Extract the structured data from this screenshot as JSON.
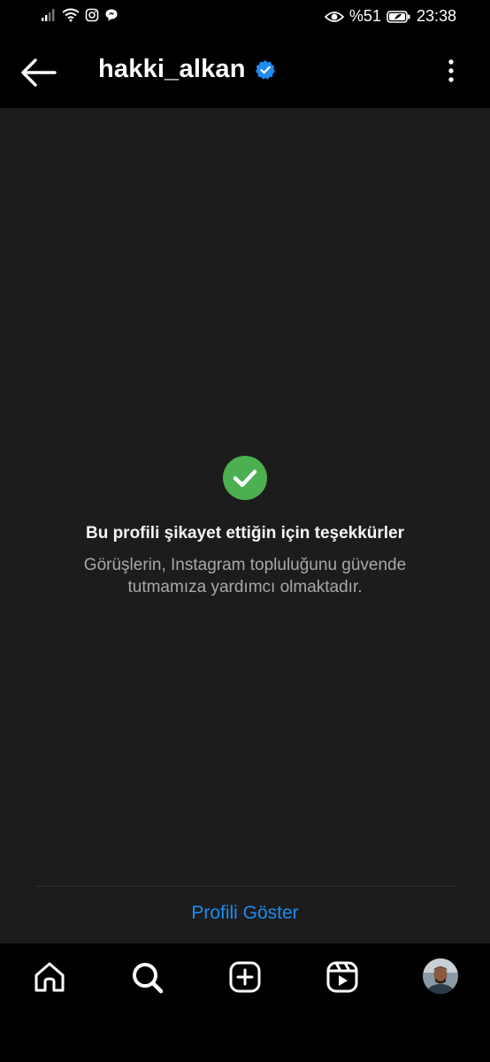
{
  "status_bar": {
    "battery": "%51",
    "time": "23:38"
  },
  "header": {
    "username": "hakki_alkan",
    "verified": true
  },
  "confirmation": {
    "title": "Bu profili şikayet ettiğin için teşekkürler",
    "body": "Görüşlerin, Instagram topluluğunu güvende tutmamıza yardımcı olmaktadır."
  },
  "actions": {
    "show_profile": "Profili Göster"
  },
  "colors": {
    "accent": "#1d8cf0",
    "success": "#4cb050",
    "background": "#1c1c1c",
    "bar": "#000000"
  },
  "bottom_nav": {
    "items": [
      "home-icon",
      "search-icon",
      "create-icon",
      "reels-icon",
      "profile-avatar"
    ]
  }
}
